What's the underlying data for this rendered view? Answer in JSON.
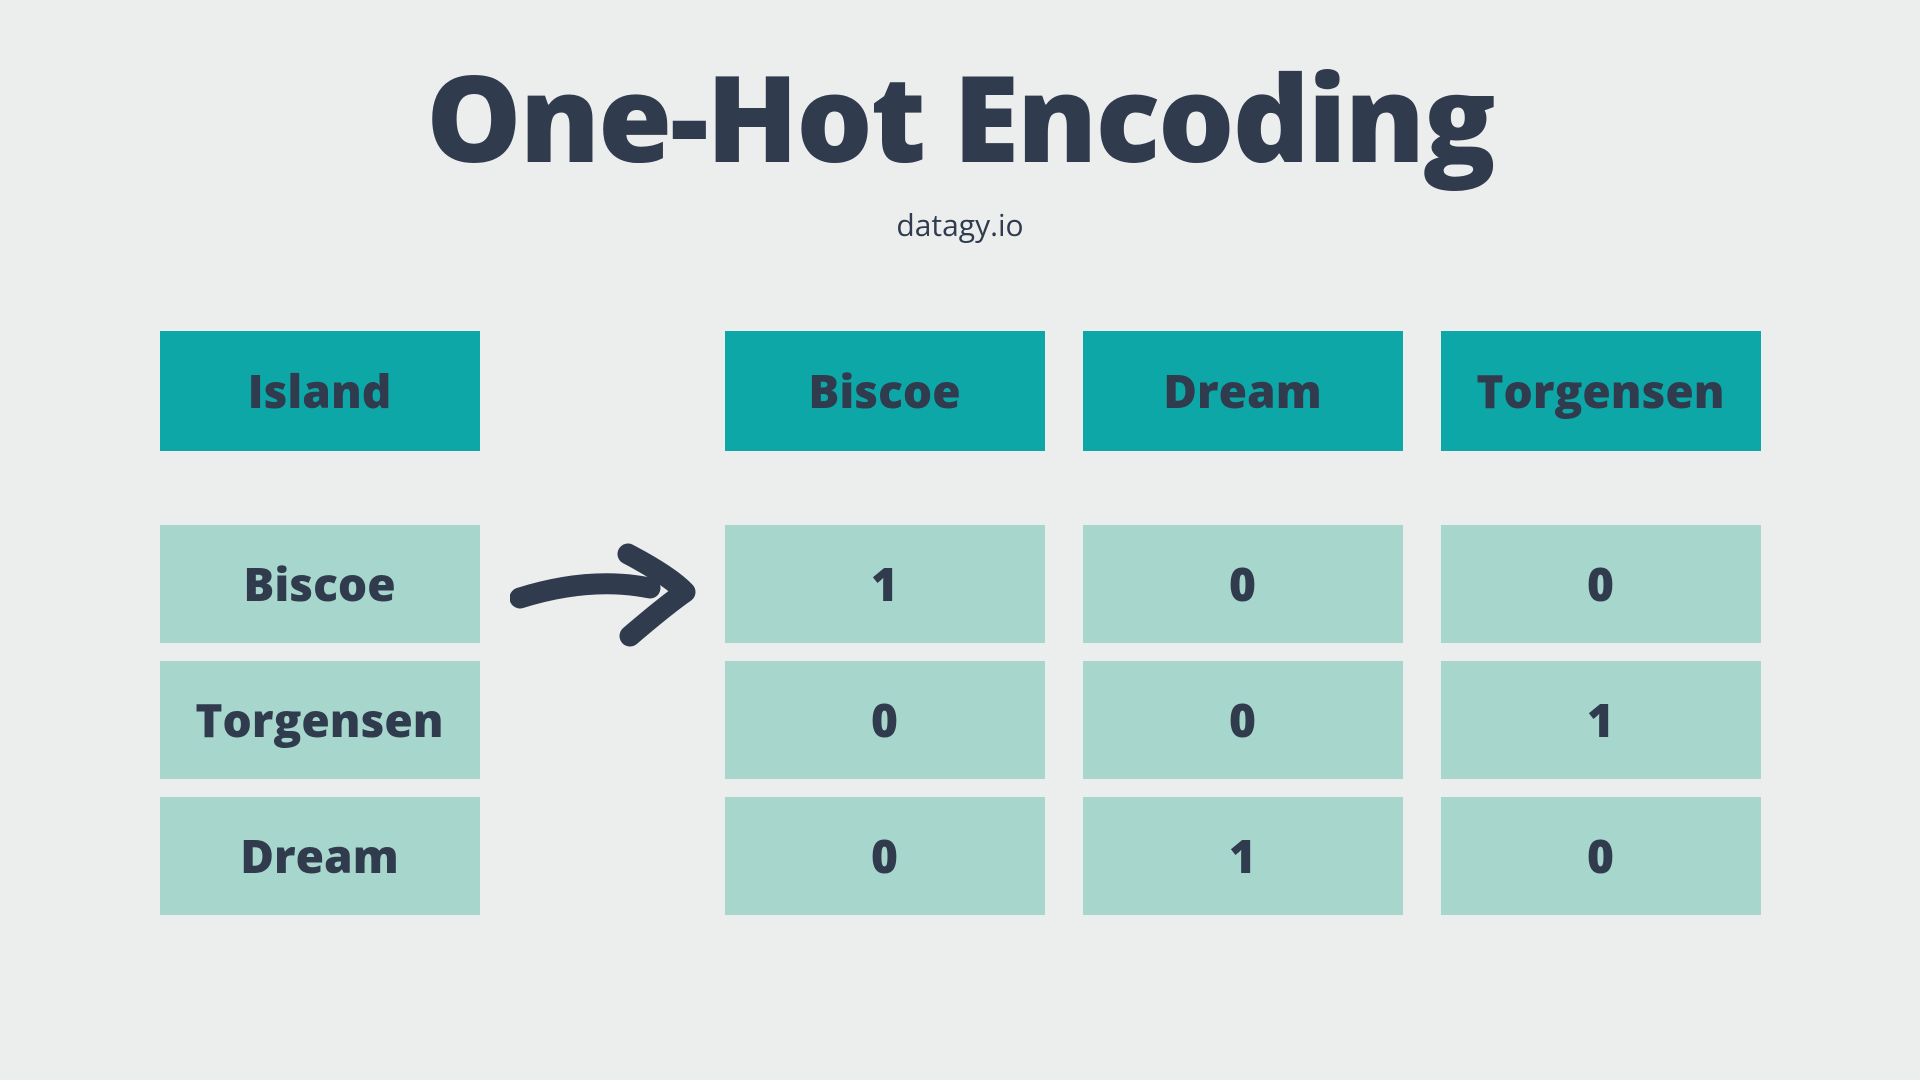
{
  "title": "One-Hot Encoding",
  "subtitle": "datagy.io",
  "left": {
    "header": "Island",
    "rows": [
      "Biscoe",
      "Torgensen",
      "Dream"
    ]
  },
  "right": {
    "headers": [
      "Biscoe",
      "Dream",
      "Torgensen"
    ],
    "rows": [
      [
        "1",
        "0",
        "0"
      ],
      [
        "0",
        "0",
        "1"
      ],
      [
        "0",
        "1",
        "0"
      ]
    ]
  }
}
